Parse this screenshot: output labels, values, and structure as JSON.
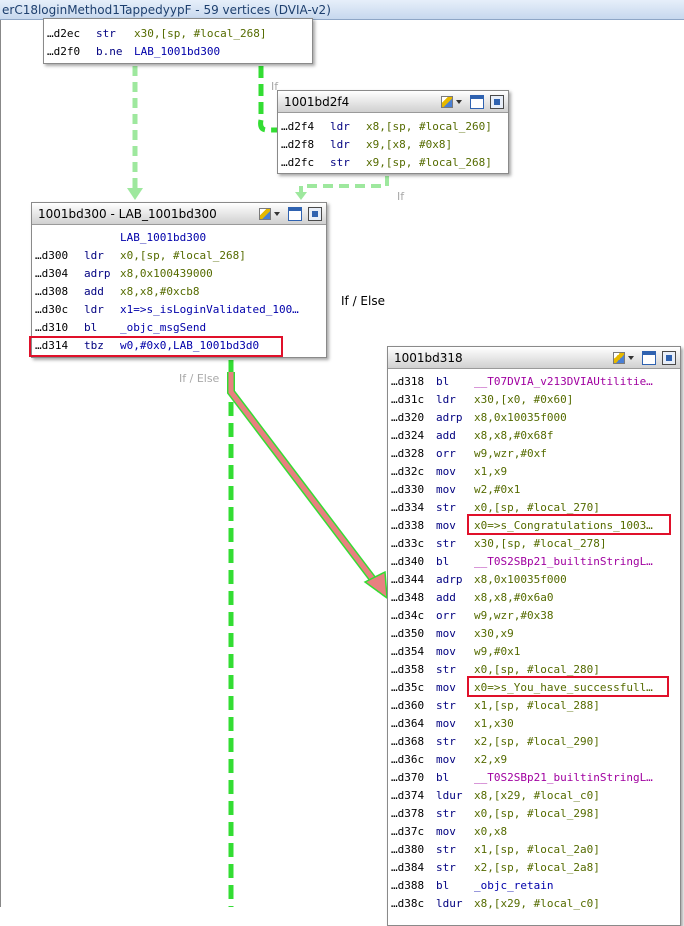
{
  "window": {
    "title": "erC18loginMethod1TappedyypF - 59 vertices  (DVIA-v2)"
  },
  "colors": {
    "edge_green": "#33dd33",
    "edge_green_light": "#9ee89e",
    "edge_red": "#e88080",
    "highlight_red": "#e0102a"
  },
  "edge_labels": {
    "left_if": "If",
    "mid_if": "If",
    "if_else_right": "If / Else",
    "if_else_bottom": "If / Else"
  },
  "blocks": {
    "top": {
      "rows": [
        {
          "addr": "…d2ec",
          "mn": "str",
          "ops": "x30,[sp, #local_268]"
        },
        {
          "addr": "…d2f0",
          "mn": "b.ne",
          "ops": "LAB_1001bd300"
        }
      ]
    },
    "b2f4": {
      "title": "1001bd2f4",
      "rows": [
        {
          "addr": "…d2f4",
          "mn": "ldr",
          "ops": "x8,[sp, #local_260]"
        },
        {
          "addr": "…d2f8",
          "mn": "ldr",
          "ops": "x9,[x8, #0x8]"
        },
        {
          "addr": "…d2fc",
          "mn": "str",
          "ops": "x9,[sp, #local_268]"
        }
      ]
    },
    "b300": {
      "title": "1001bd300 - LAB_1001bd300",
      "label": "LAB_1001bd300",
      "rows": [
        {
          "addr": "…d300",
          "mn": "ldr",
          "ops": "x0,[sp, #local_268]"
        },
        {
          "addr": "…d304",
          "mn": "adrp",
          "ops": "x8,0x100439000"
        },
        {
          "addr": "…d308",
          "mn": "add",
          "ops": "x8,x8,#0xcb8"
        },
        {
          "addr": "…d30c",
          "mn": "ldr",
          "ops": "x1=>s_isLoginValidated_100…"
        },
        {
          "addr": "…d310",
          "mn": "bl",
          "ops": "_objc_msgSend"
        },
        {
          "addr": "…d314",
          "mn": "tbz",
          "ops": "w0,#0x0,LAB_1001bd3d0"
        }
      ]
    },
    "b318": {
      "title": "1001bd318",
      "rows": [
        {
          "addr": "…d318",
          "mn": "bl",
          "ops": "__T07DVIA_v213DVIAUtilitie…"
        },
        {
          "addr": "…d31c",
          "mn": "ldr",
          "ops": "x30,[x0, #0x60]"
        },
        {
          "addr": "…d320",
          "mn": "adrp",
          "ops": "x8,0x10035f000"
        },
        {
          "addr": "…d324",
          "mn": "add",
          "ops": "x8,x8,#0x68f"
        },
        {
          "addr": "…d328",
          "mn": "orr",
          "ops": "w9,wzr,#0xf"
        },
        {
          "addr": "…d32c",
          "mn": "mov",
          "ops": "x1,x9"
        },
        {
          "addr": "…d330",
          "mn": "mov",
          "ops": "w2,#0x1"
        },
        {
          "addr": "…d334",
          "mn": "str",
          "ops": "x0,[sp, #local_270]"
        },
        {
          "addr": "…d338",
          "mn": "mov",
          "ops": "x0=>s_Congratulations_1003…"
        },
        {
          "addr": "…d33c",
          "mn": "str",
          "ops": "x30,[sp, #local_278]"
        },
        {
          "addr": "…d340",
          "mn": "bl",
          "ops": "__T0S2SBp21_builtinStringL…"
        },
        {
          "addr": "…d344",
          "mn": "adrp",
          "ops": "x8,0x10035f000"
        },
        {
          "addr": "…d348",
          "mn": "add",
          "ops": "x8,x8,#0x6a0"
        },
        {
          "addr": "…d34c",
          "mn": "orr",
          "ops": "w9,wzr,#0x38"
        },
        {
          "addr": "…d350",
          "mn": "mov",
          "ops": "x30,x9"
        },
        {
          "addr": "…d354",
          "mn": "mov",
          "ops": "w9,#0x1"
        },
        {
          "addr": "…d358",
          "mn": "str",
          "ops": "x0,[sp, #local_280]"
        },
        {
          "addr": "…d35c",
          "mn": "mov",
          "ops": "x0=>s_You_have_successfull…"
        },
        {
          "addr": "…d360",
          "mn": "str",
          "ops": "x1,[sp, #local_288]"
        },
        {
          "addr": "…d364",
          "mn": "mov",
          "ops": "x1,x30"
        },
        {
          "addr": "…d368",
          "mn": "str",
          "ops": "x2,[sp, #local_290]"
        },
        {
          "addr": "…d36c",
          "mn": "mov",
          "ops": "x2,x9"
        },
        {
          "addr": "…d370",
          "mn": "bl",
          "ops": "__T0S2SBp21_builtinStringL…"
        },
        {
          "addr": "…d374",
          "mn": "ldur",
          "ops": "x8,[x29, #local_c0]"
        },
        {
          "addr": "…d378",
          "mn": "str",
          "ops": "x0,[sp, #local_298]"
        },
        {
          "addr": "…d37c",
          "mn": "mov",
          "ops": "x0,x8"
        },
        {
          "addr": "…d380",
          "mn": "str",
          "ops": "x1,[sp, #local_2a0]"
        },
        {
          "addr": "…d384",
          "mn": "str",
          "ops": "x2,[sp, #local_2a8]"
        },
        {
          "addr": "…d388",
          "mn": "bl",
          "ops": "_objc_retain"
        },
        {
          "addr": "…d38c",
          "mn": "ldur",
          "ops": "x8,[x29, #local_c0]"
        }
      ]
    }
  }
}
